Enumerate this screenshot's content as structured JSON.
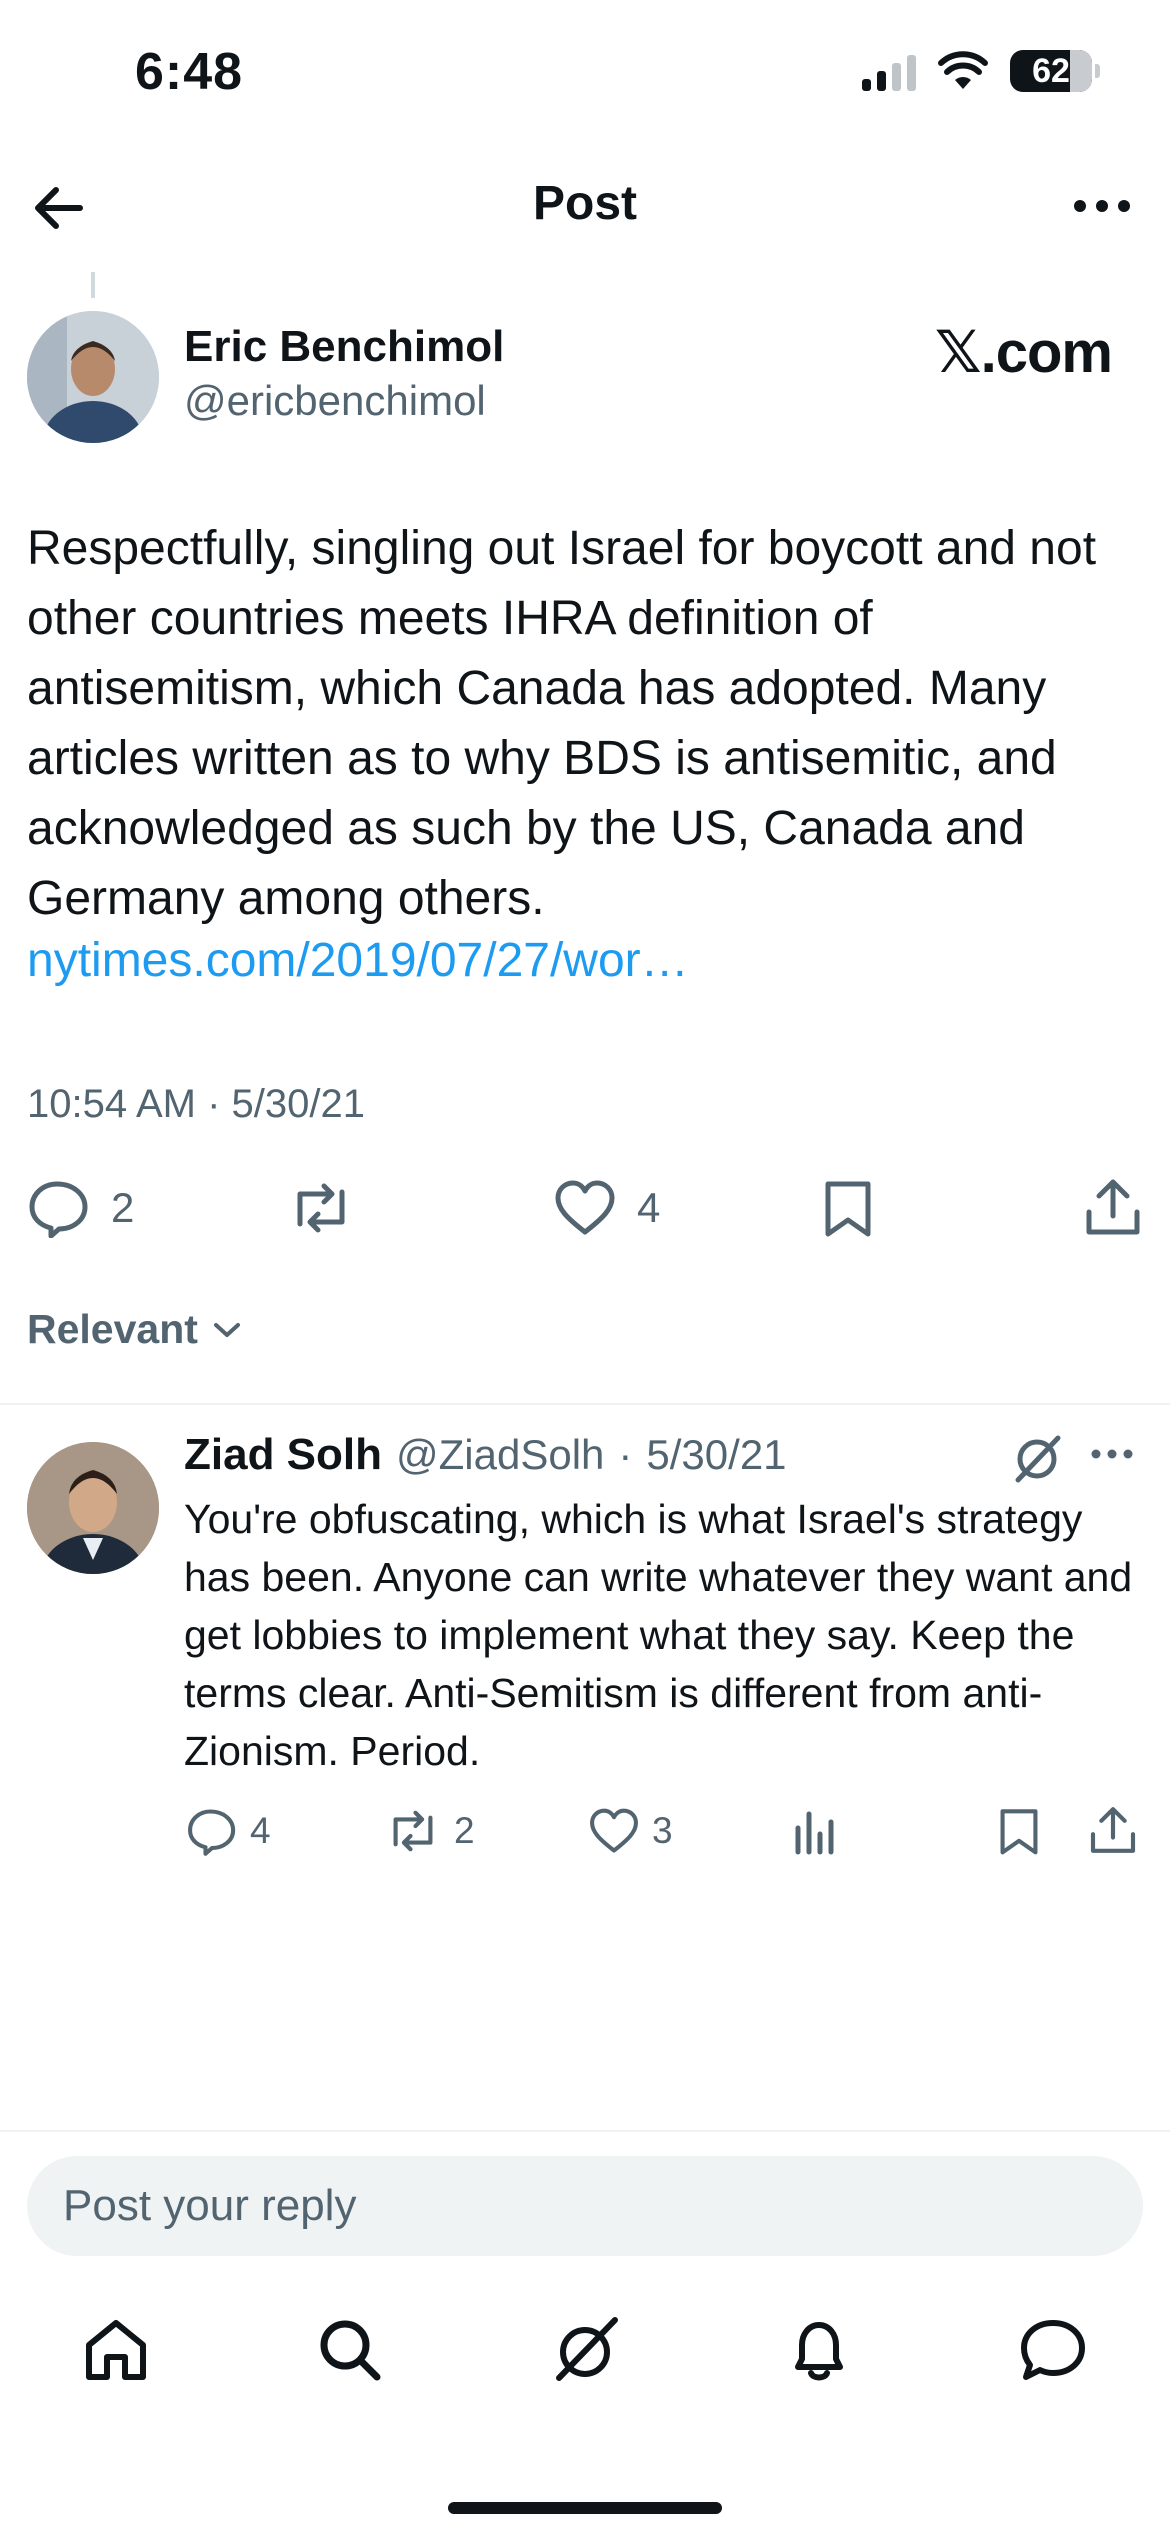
{
  "status_bar": {
    "time": "6:48",
    "battery": "62",
    "battery_fraction": 0.62,
    "icons": [
      "signal-icon",
      "wifi-icon",
      "battery-icon"
    ]
  },
  "nav": {
    "title": "Post",
    "back_icon": "arrow-left-icon",
    "more_icon": "more-horizontal-icon"
  },
  "post": {
    "author_name": "Eric Benchimol",
    "author_handle": "@ericbenchimol",
    "source_label": "𝕏.com",
    "body": "Respectfully, singling out Israel for boycott and not other countries meets IHRA definition of antisemitism, which Canada has adopted. Many articles written as to why BDS is antisemitic, and acknowledged as such by the US, Canada and Germany among others.",
    "link": "nytimes.com/2019/07/27/wor…",
    "meta": "10:54 AM · 5/30/21",
    "actions": {
      "replies": "2",
      "reposts": "",
      "likes": "4"
    }
  },
  "sort": {
    "label": "Relevant"
  },
  "reply": {
    "name": "Ziad Solh",
    "handle": "@ZiadSolh",
    "dot": "·",
    "date": "5/30/21",
    "body": "You're obfuscating, which is what Israel's strategy has been. Anyone can write whatever they want and get lobbies to implement what they say. Keep the terms clear. Anti-Semitism is different from anti-Zionism. Period.",
    "actions": {
      "replies": "4",
      "reposts": "2",
      "likes": "3"
    }
  },
  "composer": {
    "placeholder": "Post your reply"
  },
  "tabbar": {
    "items": [
      "home-icon",
      "search-icon",
      "grok-icon",
      "notifications-icon",
      "messages-icon"
    ]
  },
  "colors": {
    "text": "#0f1419",
    "secondary": "#536471",
    "link": "#1d9bf0",
    "divider": "#eff3f4"
  }
}
